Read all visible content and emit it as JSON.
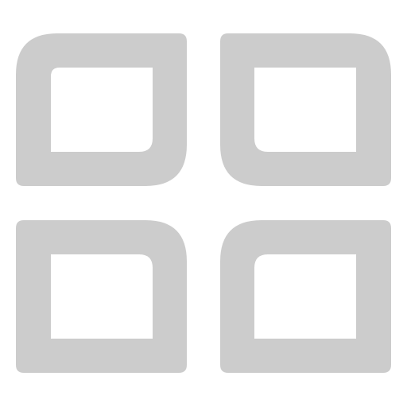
{
  "icon": {
    "name": "dashboard-grid-icon",
    "color": "#cccccc",
    "tiles": [
      {
        "name": "grid-tile-top-left-icon"
      },
      {
        "name": "grid-tile-top-right-icon"
      },
      {
        "name": "grid-tile-bottom-left-icon"
      },
      {
        "name": "grid-tile-bottom-right-icon"
      }
    ]
  }
}
